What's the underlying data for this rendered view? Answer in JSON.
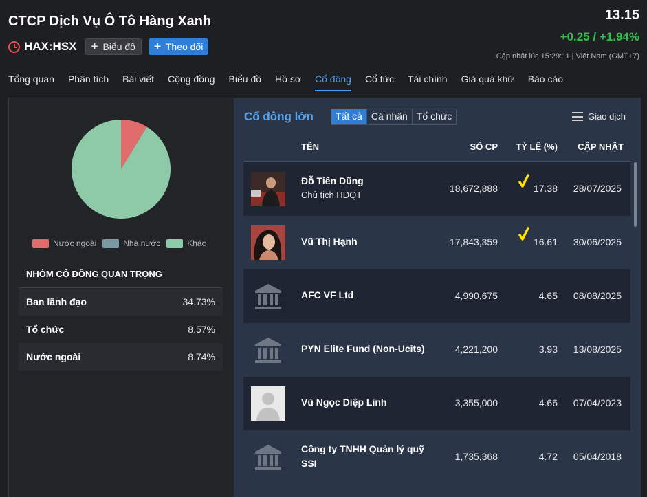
{
  "header": {
    "company_name": "CTCP Dịch Vụ Ô Tô Hàng Xanh",
    "ticker": "HAX:HSX",
    "chart_button": "Biểu đồ",
    "follow_button": "Theo dõi",
    "price": "13.15",
    "change": "+0.25 / +1.94%",
    "updated": "Cập nhật lúc  15:29:11 | Việt Nam (GMT+7)"
  },
  "tabs": [
    {
      "label": "Tổng quan"
    },
    {
      "label": "Phân tích"
    },
    {
      "label": "Bài viết"
    },
    {
      "label": "Cộng đồng"
    },
    {
      "label": "Biểu đồ"
    },
    {
      "label": "Hồ sơ"
    },
    {
      "label": "Cổ đông"
    },
    {
      "label": "Cổ tức"
    },
    {
      "label": "Tài chính"
    },
    {
      "label": "Giá quá khứ"
    },
    {
      "label": "Báo cáo"
    }
  ],
  "pie": {
    "legend": [
      {
        "label": "Nước ngoài",
        "color": "#e06c6c"
      },
      {
        "label": "Nhà nước",
        "color": "#7a9aa3"
      },
      {
        "label": "Khác",
        "color": "#8ec9a8"
      }
    ],
    "slices": [
      {
        "label": "Nước ngoài",
        "value": 8.74,
        "color": "#e06c6c"
      },
      {
        "label": "Nhà nước",
        "value": 0,
        "color": "#7a9aa3"
      },
      {
        "label": "Khác",
        "value": 91.26,
        "color": "#8ec9a8"
      }
    ]
  },
  "groups": {
    "title": "NHÓM CỔ ĐÔNG QUAN TRỌNG",
    "rows": [
      {
        "name": "Ban lãnh đạo",
        "value": "34.73%"
      },
      {
        "name": "Tổ chức",
        "value": "8.57%"
      },
      {
        "name": "Nước ngoài",
        "value": "8.74%"
      }
    ]
  },
  "holders": {
    "title": "Cổ đông lớn",
    "filters": [
      "Tất cả",
      "Cá nhân",
      "Tổ chức"
    ],
    "trade_label": "Giao dịch",
    "columns": {
      "name": "TÊN",
      "shares": "SỐ CP",
      "pct": "TỶ LỆ (%)",
      "date": "CẬP NHẬT"
    },
    "rows": [
      {
        "name": "Đỗ Tiến Dũng",
        "role": "Chủ tịch HĐQT",
        "shares": "18,672,888",
        "pct": "17.38",
        "date": "28/07/2025",
        "avatar": "person-photo-icon"
      },
      {
        "name": "Vũ Thị Hạnh",
        "role": "",
        "shares": "17,843,359",
        "pct": "16.61",
        "date": "30/06/2025",
        "avatar": "person-photo-icon"
      },
      {
        "name": "AFC VF Ltd",
        "role": "",
        "shares": "4,990,675",
        "pct": "4.65",
        "date": "08/08/2025",
        "avatar": "bank-icon"
      },
      {
        "name": "PYN Elite Fund (Non-Ucits)",
        "role": "",
        "shares": "4,221,200",
        "pct": "3.93",
        "date": "13/08/2025",
        "avatar": "bank-icon"
      },
      {
        "name": "Vũ Ngọc Diệp Linh",
        "role": "",
        "shares": "3,355,000",
        "pct": "4.66",
        "date": "07/04/2023",
        "avatar": "placeholder-person-icon"
      },
      {
        "name_line1": "Công ty TNHH Quản lý quỹ",
        "name_line2": "SSI",
        "role": "",
        "shares": "1,735,368",
        "pct": "4.72",
        "date": "05/04/2018",
        "avatar": "bank-icon"
      }
    ]
  },
  "colors": {
    "accent": "#2f7fd8",
    "positive": "#2fbf4a",
    "highlight": "#ffe000"
  }
}
